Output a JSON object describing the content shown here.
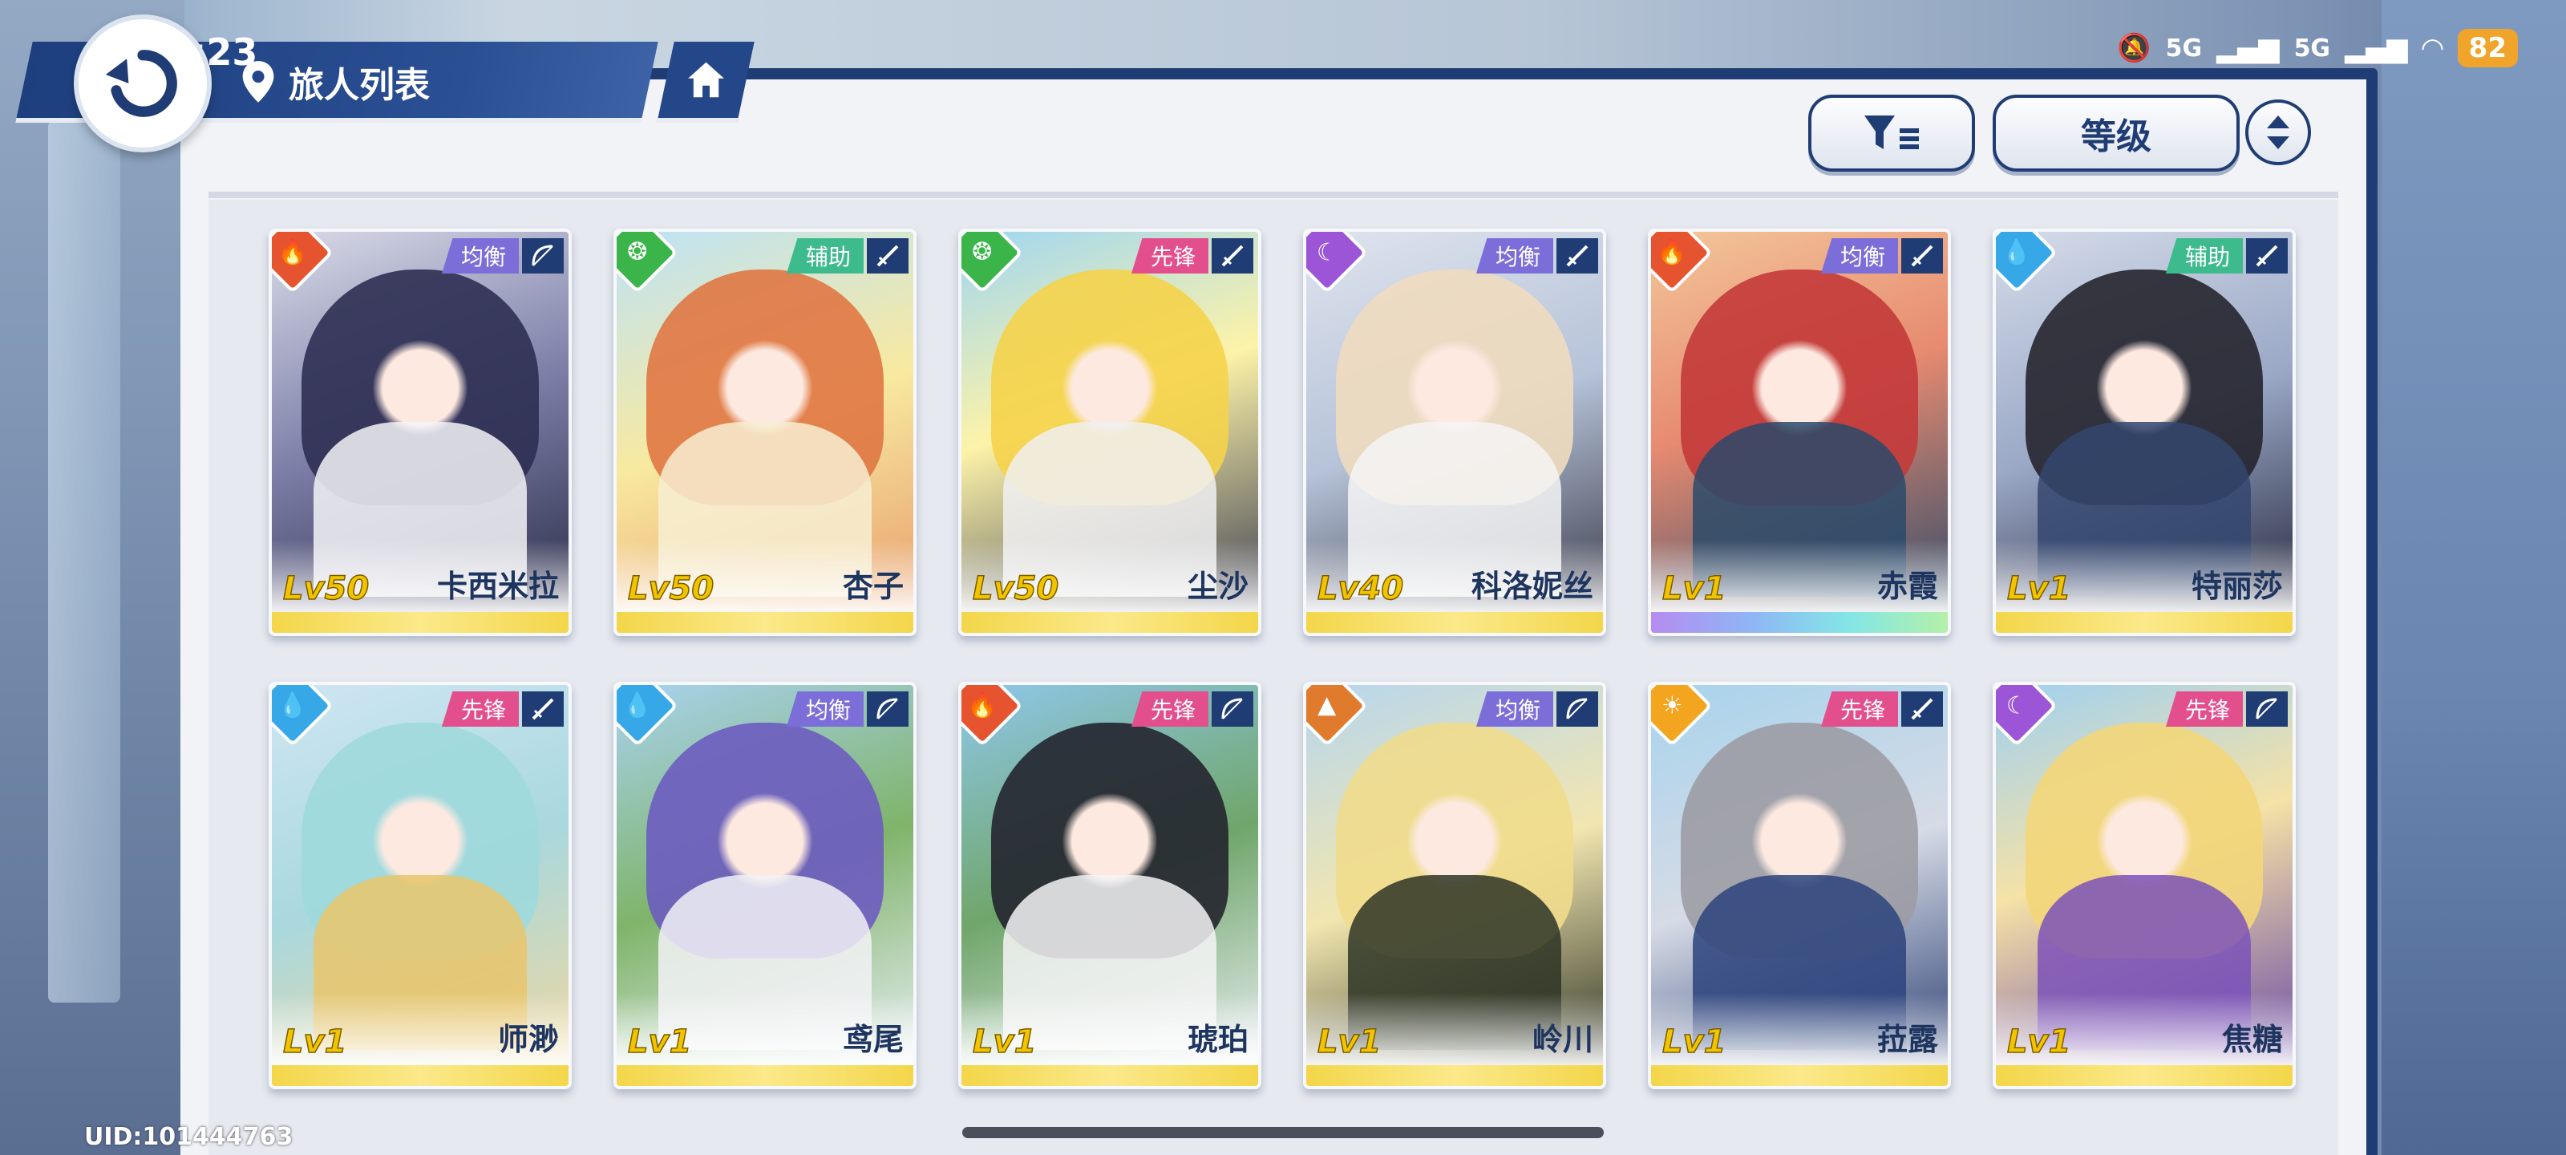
{
  "status_bar": {
    "time": "11:23",
    "network_1": "5G",
    "network_2": "5G",
    "battery": "82"
  },
  "header": {
    "title": "旅人列表"
  },
  "toolbar": {
    "sort_label": "等级"
  },
  "characters": [
    {
      "level": "Lv50",
      "name": "卡西米拉",
      "role": "均衡",
      "element": "fire-icon",
      "weapon": "bow-icon"
    },
    {
      "level": "Lv50",
      "name": "杏子",
      "role": "辅助",
      "element": "wind-icon",
      "weapon": "sword-icon"
    },
    {
      "level": "Lv50",
      "name": "尘沙",
      "role": "先锋",
      "element": "wind-icon",
      "weapon": "sword-icon"
    },
    {
      "level": "Lv40",
      "name": "科洛妮丝",
      "role": "均衡",
      "element": "moon-icon",
      "weapon": "sword-icon"
    },
    {
      "level": "Lv1",
      "name": "赤霞",
      "role": "均衡",
      "element": "fire-icon",
      "weapon": "sword-icon"
    },
    {
      "level": "Lv1",
      "name": "特丽莎",
      "role": "辅助",
      "element": "water-icon",
      "weapon": "sword-icon"
    },
    {
      "level": "Lv1",
      "name": "师渺",
      "role": "先锋",
      "element": "water-icon",
      "weapon": "sword-icon"
    },
    {
      "level": "Lv1",
      "name": "鸢尾",
      "role": "均衡",
      "element": "water-icon",
      "weapon": "bow-icon"
    },
    {
      "level": "Lv1",
      "name": "琥珀",
      "role": "先锋",
      "element": "fire-icon",
      "weapon": "bow-icon"
    },
    {
      "level": "Lv1",
      "name": "岭川",
      "role": "均衡",
      "element": "earth-icon",
      "weapon": "bow-icon"
    },
    {
      "level": "Lv1",
      "name": "菈露",
      "role": "先锋",
      "element": "sun-icon",
      "weapon": "sword-icon"
    },
    {
      "level": "Lv1",
      "name": "焦糖",
      "role": "先锋",
      "element": "moon-icon",
      "weapon": "bow-icon"
    }
  ],
  "footer": {
    "uid": "UID:101444763"
  }
}
